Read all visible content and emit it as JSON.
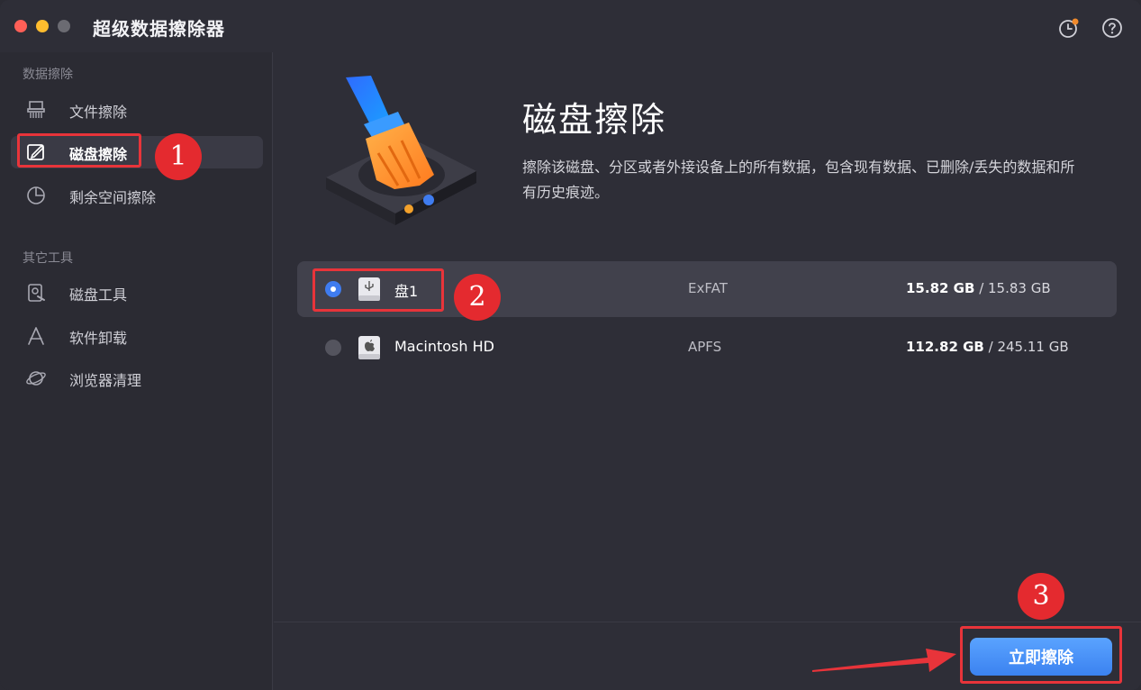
{
  "app": {
    "title": "超级数据擦除器"
  },
  "sidebar": {
    "sections": [
      {
        "label": "数据擦除",
        "items": [
          {
            "label": "文件擦除",
            "icon": "shredder-icon",
            "active": false
          },
          {
            "label": "磁盘擦除",
            "icon": "disk-edit-icon",
            "active": true
          },
          {
            "label": "剩余空间擦除",
            "icon": "pie-chart-icon",
            "active": false
          }
        ]
      },
      {
        "label": "其它工具",
        "items": [
          {
            "label": "磁盘工具",
            "icon": "disk-tool-icon",
            "active": false
          },
          {
            "label": "软件卸载",
            "icon": "app-uninstall-icon",
            "active": false
          },
          {
            "label": "浏览器清理",
            "icon": "planet-icon",
            "active": false
          }
        ]
      }
    ]
  },
  "main": {
    "title": "磁盘擦除",
    "description": "擦除该磁盘、分区或者外接设备上的所有数据，包含现有数据、已删除/丢失的数据和所有历史痕迹。",
    "drives": [
      {
        "name": "盘1",
        "fs": "ExFAT",
        "used": "15.82 GB",
        "separator": " / ",
        "total": "15.83 GB",
        "selected": true,
        "icon": "usb-drive-icon"
      },
      {
        "name": "Macintosh HD",
        "fs": "APFS",
        "used": "112.82 GB",
        "separator": " / ",
        "total": "245.11 GB",
        "selected": false,
        "icon": "apple-drive-icon"
      }
    ],
    "wipe_button": "立即擦除"
  },
  "annotations": {
    "step1": "1",
    "step2": "2",
    "step3": "3"
  },
  "colors": {
    "accent": "#3f7cf0",
    "highlight": "#e8343a",
    "background": "#2e2e37"
  }
}
